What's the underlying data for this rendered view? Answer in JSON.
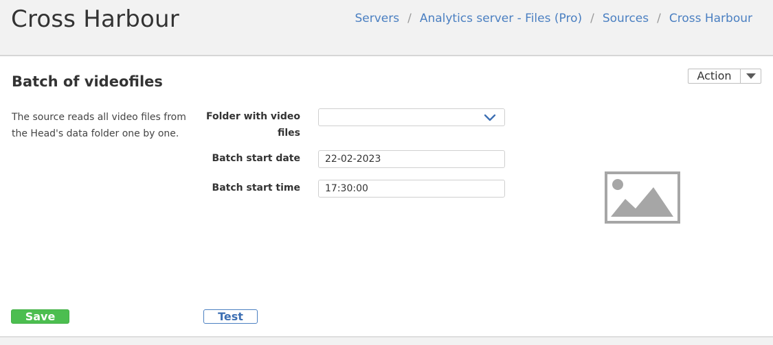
{
  "header": {
    "title": "Cross Harbour",
    "breadcrumb": [
      {
        "label": "Servers"
      },
      {
        "label": "Analytics server - Files (Pro)"
      },
      {
        "label": "Sources"
      },
      {
        "label": "Cross Harbour"
      }
    ],
    "separator": "/"
  },
  "section": {
    "title": "Batch of videofiles",
    "action_label": "Action",
    "description": "The source reads all video files from the Head's data folder one by one."
  },
  "form": {
    "folder_label": "Folder with video files",
    "folder_value": "",
    "date_label": "Batch start date",
    "date_value": "22-02-2023",
    "time_label": "Batch start time",
    "time_value": "17:30:00"
  },
  "buttons": {
    "save": "Save",
    "test": "Test"
  },
  "icons": {
    "action_caret": "caret-down-icon",
    "folder_dropdown": "chevron-down-icon",
    "preview": "image-placeholder-icon"
  },
  "colors": {
    "accent": "#4a7fc1",
    "save": "#4cbe50",
    "placeholder_gray": "#a6a6a6"
  }
}
